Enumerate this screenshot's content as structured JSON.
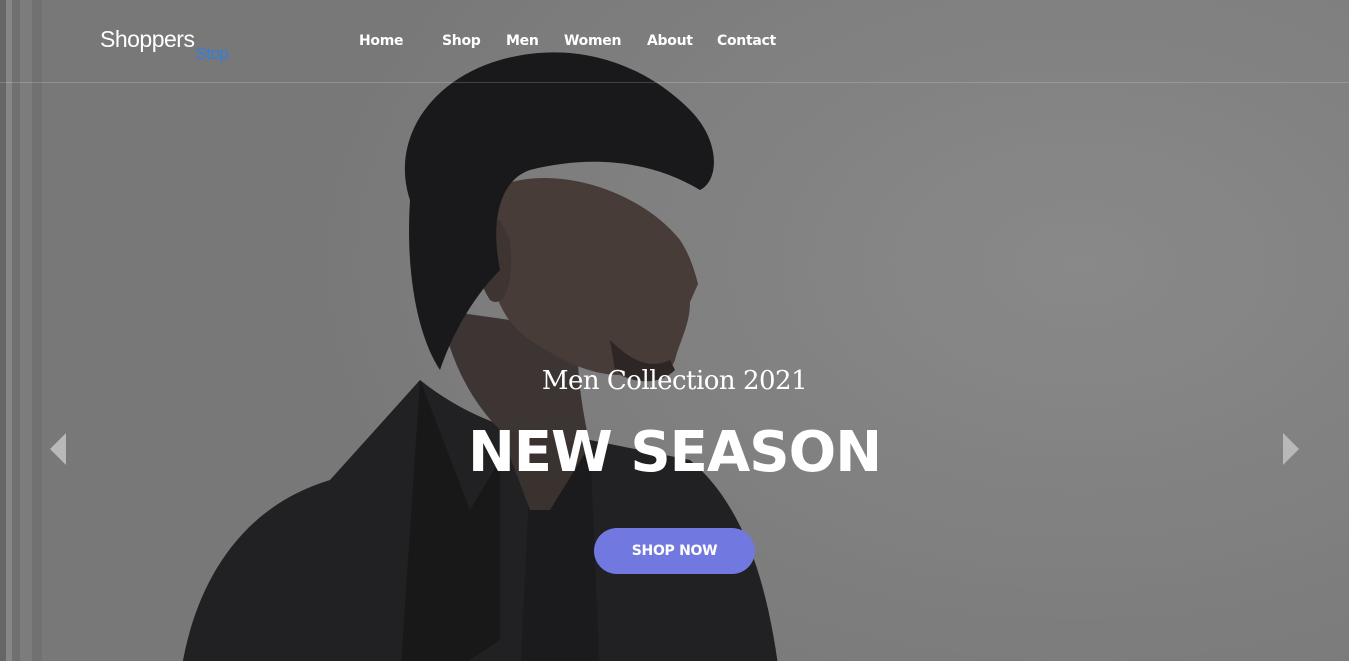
{
  "header": {
    "logo_main": "Shoppers",
    "logo_sub": "Stop",
    "nav": [
      {
        "label": "Home"
      },
      {
        "label": "Shop"
      },
      {
        "label": "Men"
      },
      {
        "label": "Women"
      },
      {
        "label": "About"
      },
      {
        "label": "Contact"
      }
    ]
  },
  "hero": {
    "subtitle": "Men Collection 2021",
    "title": "NEW SEASON",
    "cta_label": "SHOP NOW"
  },
  "carousel": {
    "prev_icon": "chevron-left-icon",
    "next_icon": "chevron-right-icon"
  },
  "colors": {
    "accent": "#7179e0",
    "logo_sub": "#2f7ee0"
  }
}
